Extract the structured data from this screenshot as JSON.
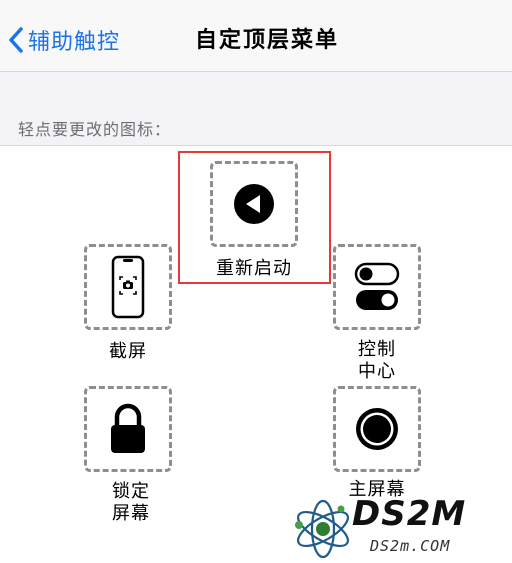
{
  "nav": {
    "back_label": "辅助触控",
    "title": "自定顶层菜单"
  },
  "section": {
    "header": "轻点要更改的图标："
  },
  "slots": {
    "restart": {
      "label": "重新启动",
      "icon": "back-arrow-circle-icon"
    },
    "screenshot": {
      "label": "截屏",
      "icon": "screenshot-phone-icon"
    },
    "control_center": {
      "label_line1": "控制",
      "label_line2": "中心",
      "icon": "toggle-switches-icon"
    },
    "lock_screen": {
      "label_line1": "锁定",
      "label_line2": "屏幕",
      "icon": "lock-icon"
    },
    "home_screen": {
      "label": "主屏幕",
      "icon": "home-button-icon"
    }
  },
  "highlight": {
    "color": "#e53935",
    "target": "restart"
  },
  "watermark": {
    "logo_text": "DS2M",
    "url": "DS2m.COM"
  },
  "colors": {
    "accent": "#1a73e8",
    "nav_background": "#f8f8f8",
    "section_background": "#f2f2f7",
    "slot_border": "#8e8e8e"
  }
}
